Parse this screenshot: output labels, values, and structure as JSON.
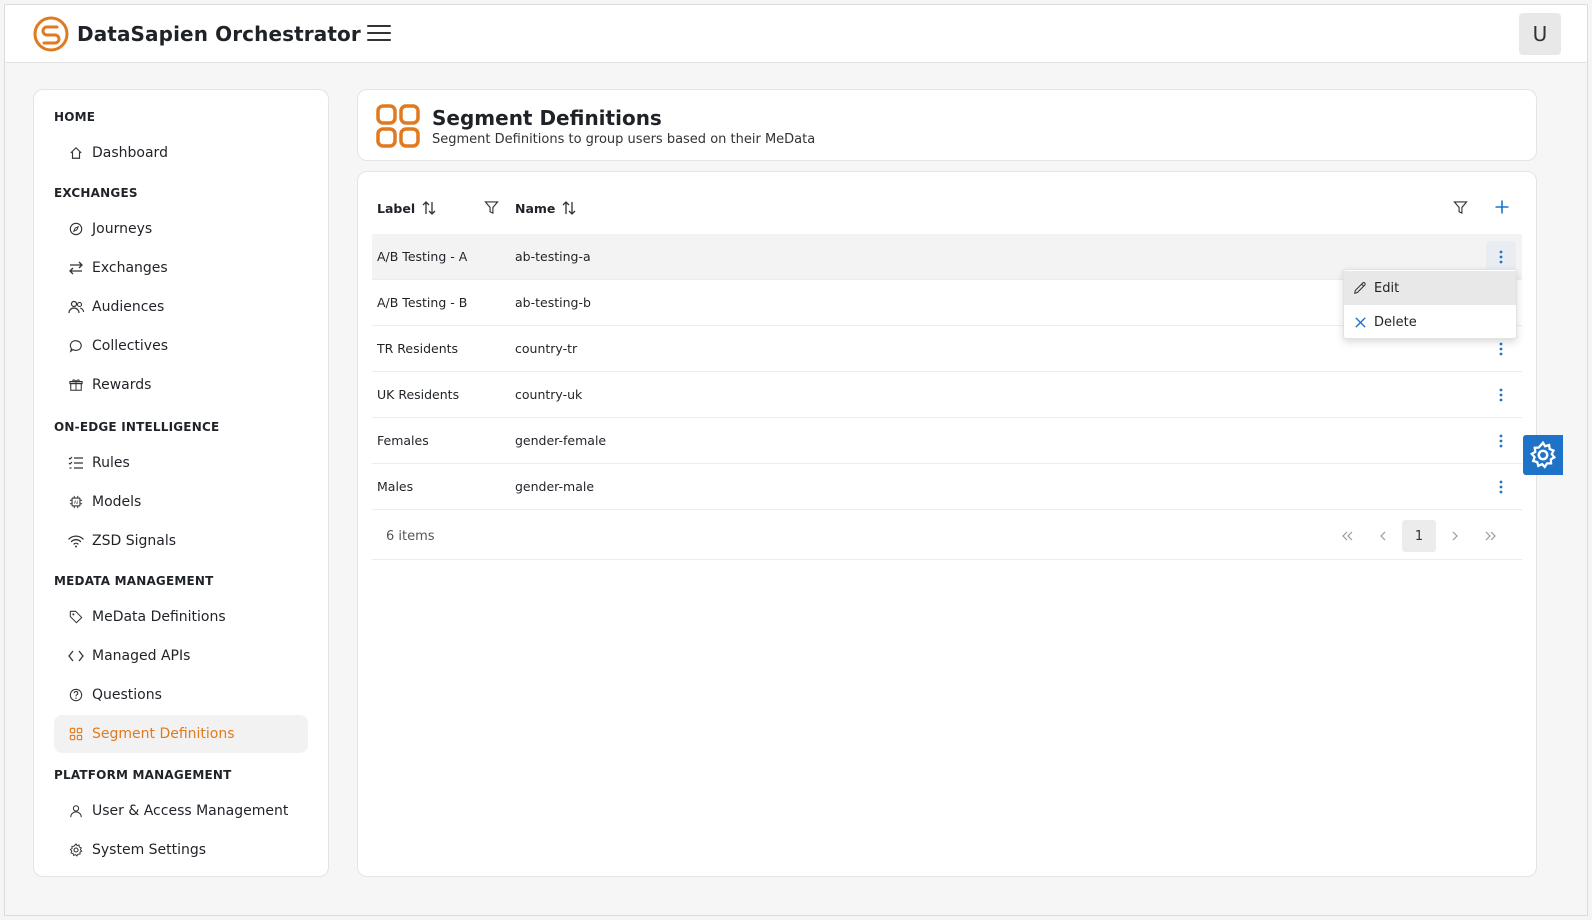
{
  "app": {
    "title": "DataSapien Orchestrator",
    "user_initial": "U"
  },
  "sidebar": {
    "sections": [
      {
        "title": "HOME",
        "items": [
          {
            "label": "Dashboard",
            "icon": "home-icon"
          }
        ]
      },
      {
        "title": "EXCHANGES",
        "items": [
          {
            "label": "Journeys",
            "icon": "compass-icon"
          },
          {
            "label": "Exchanges",
            "icon": "arrows-swap-icon"
          },
          {
            "label": "Audiences",
            "icon": "people-icon"
          },
          {
            "label": "Collectives",
            "icon": "chat-icon"
          },
          {
            "label": "Rewards",
            "icon": "gift-icon"
          }
        ]
      },
      {
        "title": "ON-EDGE INTELLIGENCE",
        "items": [
          {
            "label": "Rules",
            "icon": "list-check-icon"
          },
          {
            "label": "Models",
            "icon": "chip-icon"
          },
          {
            "label": "ZSD Signals",
            "icon": "wifi-icon"
          }
        ]
      },
      {
        "title": "MEDATA MANAGEMENT",
        "items": [
          {
            "label": "MeData Definitions",
            "icon": "tag-icon"
          },
          {
            "label": "Managed APIs",
            "icon": "code-icon"
          },
          {
            "label": "Questions",
            "icon": "question-circle-icon"
          },
          {
            "label": "Segment Definitions",
            "icon": "grid-icon"
          }
        ]
      },
      {
        "title": "PLATFORM MANAGEMENT",
        "items": [
          {
            "label": "User & Access Management",
            "icon": "user-icon"
          },
          {
            "label": "System Settings",
            "icon": "gear-icon"
          }
        ]
      }
    ]
  },
  "page": {
    "title": "Segment Definitions",
    "subtitle": "Segment Definitions to group users based on their MeData"
  },
  "table": {
    "columns": {
      "label": "Label",
      "name": "Name"
    },
    "rows": [
      {
        "label": "A/B Testing - A",
        "name": "ab-testing-a"
      },
      {
        "label": "A/B Testing - B",
        "name": "ab-testing-b"
      },
      {
        "label": "TR Residents",
        "name": "country-tr"
      },
      {
        "label": "UK Residents",
        "name": "country-uk"
      },
      {
        "label": "Females",
        "name": "gender-female"
      },
      {
        "label": "Males",
        "name": "gender-male"
      }
    ],
    "items_count": "6 items",
    "current_page": "1"
  },
  "row_menu": {
    "edit": "Edit",
    "delete": "Delete"
  },
  "colors": {
    "accent": "#e07a1f",
    "primary": "#1e73c8"
  }
}
